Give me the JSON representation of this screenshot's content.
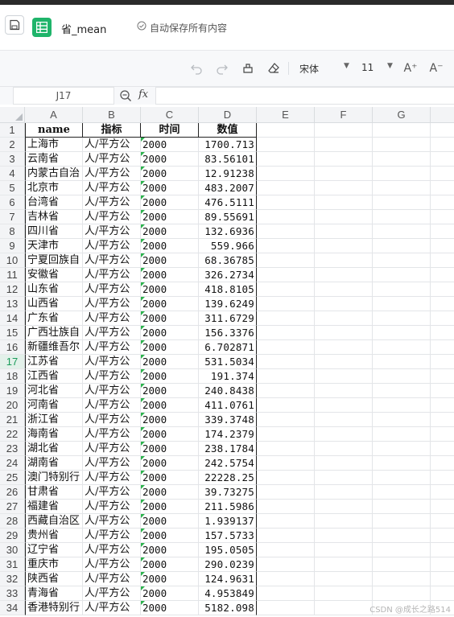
{
  "header": {
    "file_title": "省_mean",
    "autosave_text": "自动保存所有内容"
  },
  "toolbar": {
    "font_name": "宋体",
    "font_size": "11",
    "increase_font": "A⁺",
    "decrease_font": "A⁻"
  },
  "formula_bar": {
    "cell_ref": "J17",
    "fx_label": "fx",
    "value": ""
  },
  "grid": {
    "columns": [
      "A",
      "B",
      "C",
      "D",
      "E",
      "F",
      "G"
    ],
    "active_row": "17",
    "headers": [
      "name",
      "指标",
      "时间",
      "数值"
    ],
    "rows": [
      {
        "num": "2",
        "name": "上海市",
        "indicator": "人/平方公",
        "year": "2000",
        "value": "1700.713"
      },
      {
        "num": "3",
        "name": "云南省",
        "indicator": "人/平方公",
        "year": "2000",
        "value": "83.56101"
      },
      {
        "num": "4",
        "name": "内蒙古自治",
        "indicator": "人/平方公",
        "year": "2000",
        "value": "12.91238"
      },
      {
        "num": "5",
        "name": "北京市",
        "indicator": "人/平方公",
        "year": "2000",
        "value": "483.2007"
      },
      {
        "num": "6",
        "name": "台湾省",
        "indicator": "人/平方公",
        "year": "2000",
        "value": "476.5111"
      },
      {
        "num": "7",
        "name": "吉林省",
        "indicator": "人/平方公",
        "year": "2000",
        "value": "89.55691"
      },
      {
        "num": "8",
        "name": "四川省",
        "indicator": "人/平方公",
        "year": "2000",
        "value": "132.6936"
      },
      {
        "num": "9",
        "name": "天津市",
        "indicator": "人/平方公",
        "year": "2000",
        "value": "559.966"
      },
      {
        "num": "10",
        "name": "宁夏回族自",
        "indicator": "人/平方公",
        "year": "2000",
        "value": "68.36785"
      },
      {
        "num": "11",
        "name": "安徽省",
        "indicator": "人/平方公",
        "year": "2000",
        "value": "326.2734"
      },
      {
        "num": "12",
        "name": "山东省",
        "indicator": "人/平方公",
        "year": "2000",
        "value": "418.8105"
      },
      {
        "num": "13",
        "name": "山西省",
        "indicator": "人/平方公",
        "year": "2000",
        "value": "139.6249"
      },
      {
        "num": "14",
        "name": "广东省",
        "indicator": "人/平方公",
        "year": "2000",
        "value": "311.6729"
      },
      {
        "num": "15",
        "name": "广西壮族自",
        "indicator": "人/平方公",
        "year": "2000",
        "value": "156.3376"
      },
      {
        "num": "16",
        "name": "新疆维吾尔",
        "indicator": "人/平方公",
        "year": "2000",
        "value": "6.702871"
      },
      {
        "num": "17",
        "name": "江苏省",
        "indicator": "人/平方公",
        "year": "2000",
        "value": "531.5034"
      },
      {
        "num": "18",
        "name": "江西省",
        "indicator": "人/平方公",
        "year": "2000",
        "value": "191.374"
      },
      {
        "num": "19",
        "name": "河北省",
        "indicator": "人/平方公",
        "year": "2000",
        "value": "240.8438"
      },
      {
        "num": "20",
        "name": "河南省",
        "indicator": "人/平方公",
        "year": "2000",
        "value": "411.0761"
      },
      {
        "num": "21",
        "name": "浙江省",
        "indicator": "人/平方公",
        "year": "2000",
        "value": "339.3748"
      },
      {
        "num": "22",
        "name": "海南省",
        "indicator": "人/平方公",
        "year": "2000",
        "value": "174.2379"
      },
      {
        "num": "23",
        "name": "湖北省",
        "indicator": "人/平方公",
        "year": "2000",
        "value": "238.1784"
      },
      {
        "num": "24",
        "name": "湖南省",
        "indicator": "人/平方公",
        "year": "2000",
        "value": "242.5754"
      },
      {
        "num": "25",
        "name": "澳门特别行",
        "indicator": "人/平方公",
        "year": "2000",
        "value": "22228.25"
      },
      {
        "num": "26",
        "name": "甘肃省",
        "indicator": "人/平方公",
        "year": "2000",
        "value": "39.73275"
      },
      {
        "num": "27",
        "name": "福建省",
        "indicator": "人/平方公",
        "year": "2000",
        "value": "211.5986"
      },
      {
        "num": "28",
        "name": "西藏自治区",
        "indicator": "人/平方公",
        "year": "2000",
        "value": "1.939137"
      },
      {
        "num": "29",
        "name": "贵州省",
        "indicator": "人/平方公",
        "year": "2000",
        "value": "157.5733"
      },
      {
        "num": "30",
        "name": "辽宁省",
        "indicator": "人/平方公",
        "year": "2000",
        "value": "195.0505"
      },
      {
        "num": "31",
        "name": "重庆市",
        "indicator": "人/平方公",
        "year": "2000",
        "value": "290.0239"
      },
      {
        "num": "32",
        "name": "陕西省",
        "indicator": "人/平方公",
        "year": "2000",
        "value": "124.9631"
      },
      {
        "num": "33",
        "name": "青海省",
        "indicator": "人/平方公",
        "year": "2000",
        "value": "4.953849"
      },
      {
        "num": "34",
        "name": "香港特别行",
        "indicator": "人/平方公",
        "year": "2000",
        "value": "5182.098"
      }
    ]
  },
  "watermark": "CSDN @成长之路514",
  "colors": {
    "accent_green": "#1fb46a",
    "error_flag": "#2bb24c"
  }
}
